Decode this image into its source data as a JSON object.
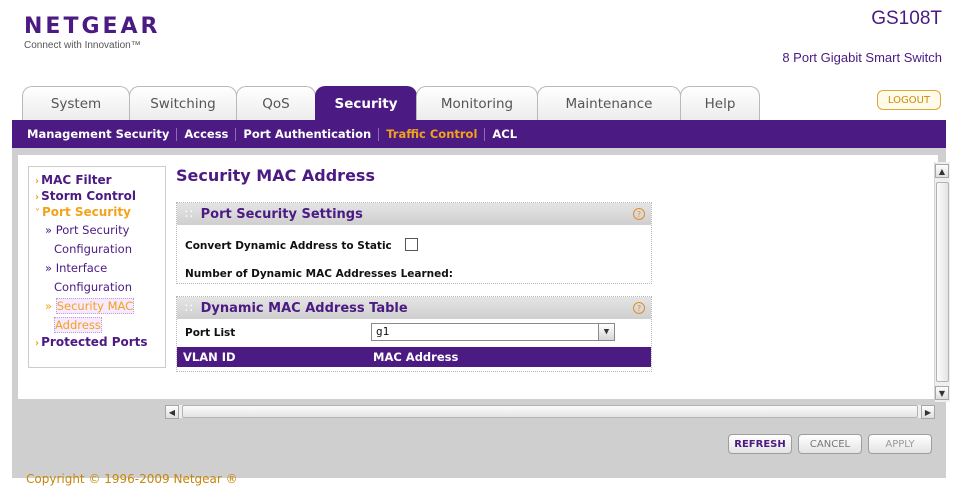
{
  "header": {
    "brand": "NETGEAR",
    "tagline": "Connect with Innovation™",
    "model": "GS108T",
    "model_desc": "8 Port Gigabit Smart Switch",
    "logout_label": "LOGOUT"
  },
  "tabs": [
    {
      "label": "System"
    },
    {
      "label": "Switching"
    },
    {
      "label": "QoS"
    },
    {
      "label": "Security"
    },
    {
      "label": "Monitoring"
    },
    {
      "label": "Maintenance"
    },
    {
      "label": "Help"
    }
  ],
  "active_tab": "Security",
  "subnav": [
    {
      "label": "Management Security"
    },
    {
      "label": "Access"
    },
    {
      "label": "Port Authentication"
    },
    {
      "label": "Traffic Control"
    },
    {
      "label": "ACL"
    }
  ],
  "active_subnav": "Traffic Control",
  "sidebar": {
    "items": [
      {
        "label": "MAC Filter"
      },
      {
        "label": "Storm Control"
      },
      {
        "label": "Port Security"
      },
      {
        "label": "Protected Ports"
      }
    ],
    "port_security_children": [
      {
        "line1": "Port Security",
        "line2": "Configuration"
      },
      {
        "line1": "Interface",
        "line2": "Configuration"
      },
      {
        "line1": "Security MAC",
        "line2": "Address"
      }
    ]
  },
  "main": {
    "title": "Security MAC Address",
    "settings_panel": {
      "title": "Port Security Settings",
      "convert_label": "Convert Dynamic Address to Static",
      "convert_checked": false,
      "learned_label": "Number of Dynamic MAC Addresses Learned:",
      "learned_value": ""
    },
    "table_panel": {
      "title": "Dynamic MAC Address Table",
      "port_list_label": "Port List",
      "port_list_value": "g1",
      "columns": [
        "VLAN ID",
        "MAC Address"
      ],
      "rows": []
    }
  },
  "footer": {
    "refresh_label": "REFRESH",
    "cancel_label": "CANCEL",
    "apply_label": "APPLY",
    "copyright": "Copyright © 1996-2009 Netgear ®"
  },
  "colors": {
    "brand_purple": "#4b1a83",
    "accent_orange": "#f2a31b"
  }
}
